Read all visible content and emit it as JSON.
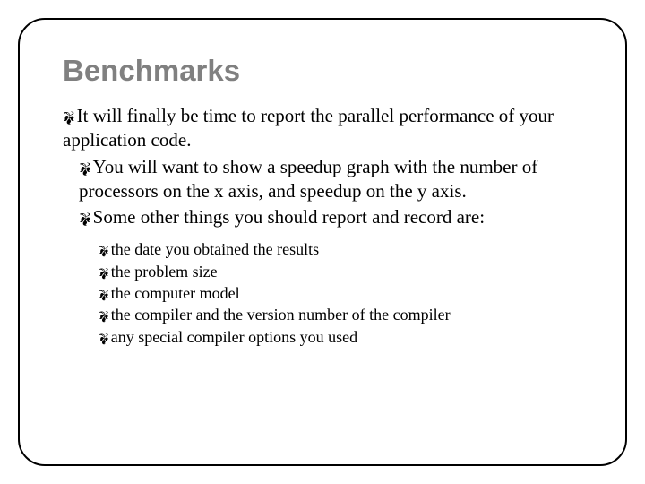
{
  "title": "Benchmarks",
  "bullet_glyph": "؄",
  "content": {
    "level1": {
      "text": "It will finally be time to report the parallel performance of your application code."
    },
    "level2": [
      {
        "text": "You will want to show a speedup graph with the number of processors on the x axis, and speedup on the y axis."
      },
      {
        "text": "Some other things you should report and record are:",
        "level3": [
          "the date you obtained the results",
          "the problem size",
          "the computer model",
          "the compiler and the version number of the compiler",
          "any special compiler options you used"
        ]
      }
    ]
  }
}
